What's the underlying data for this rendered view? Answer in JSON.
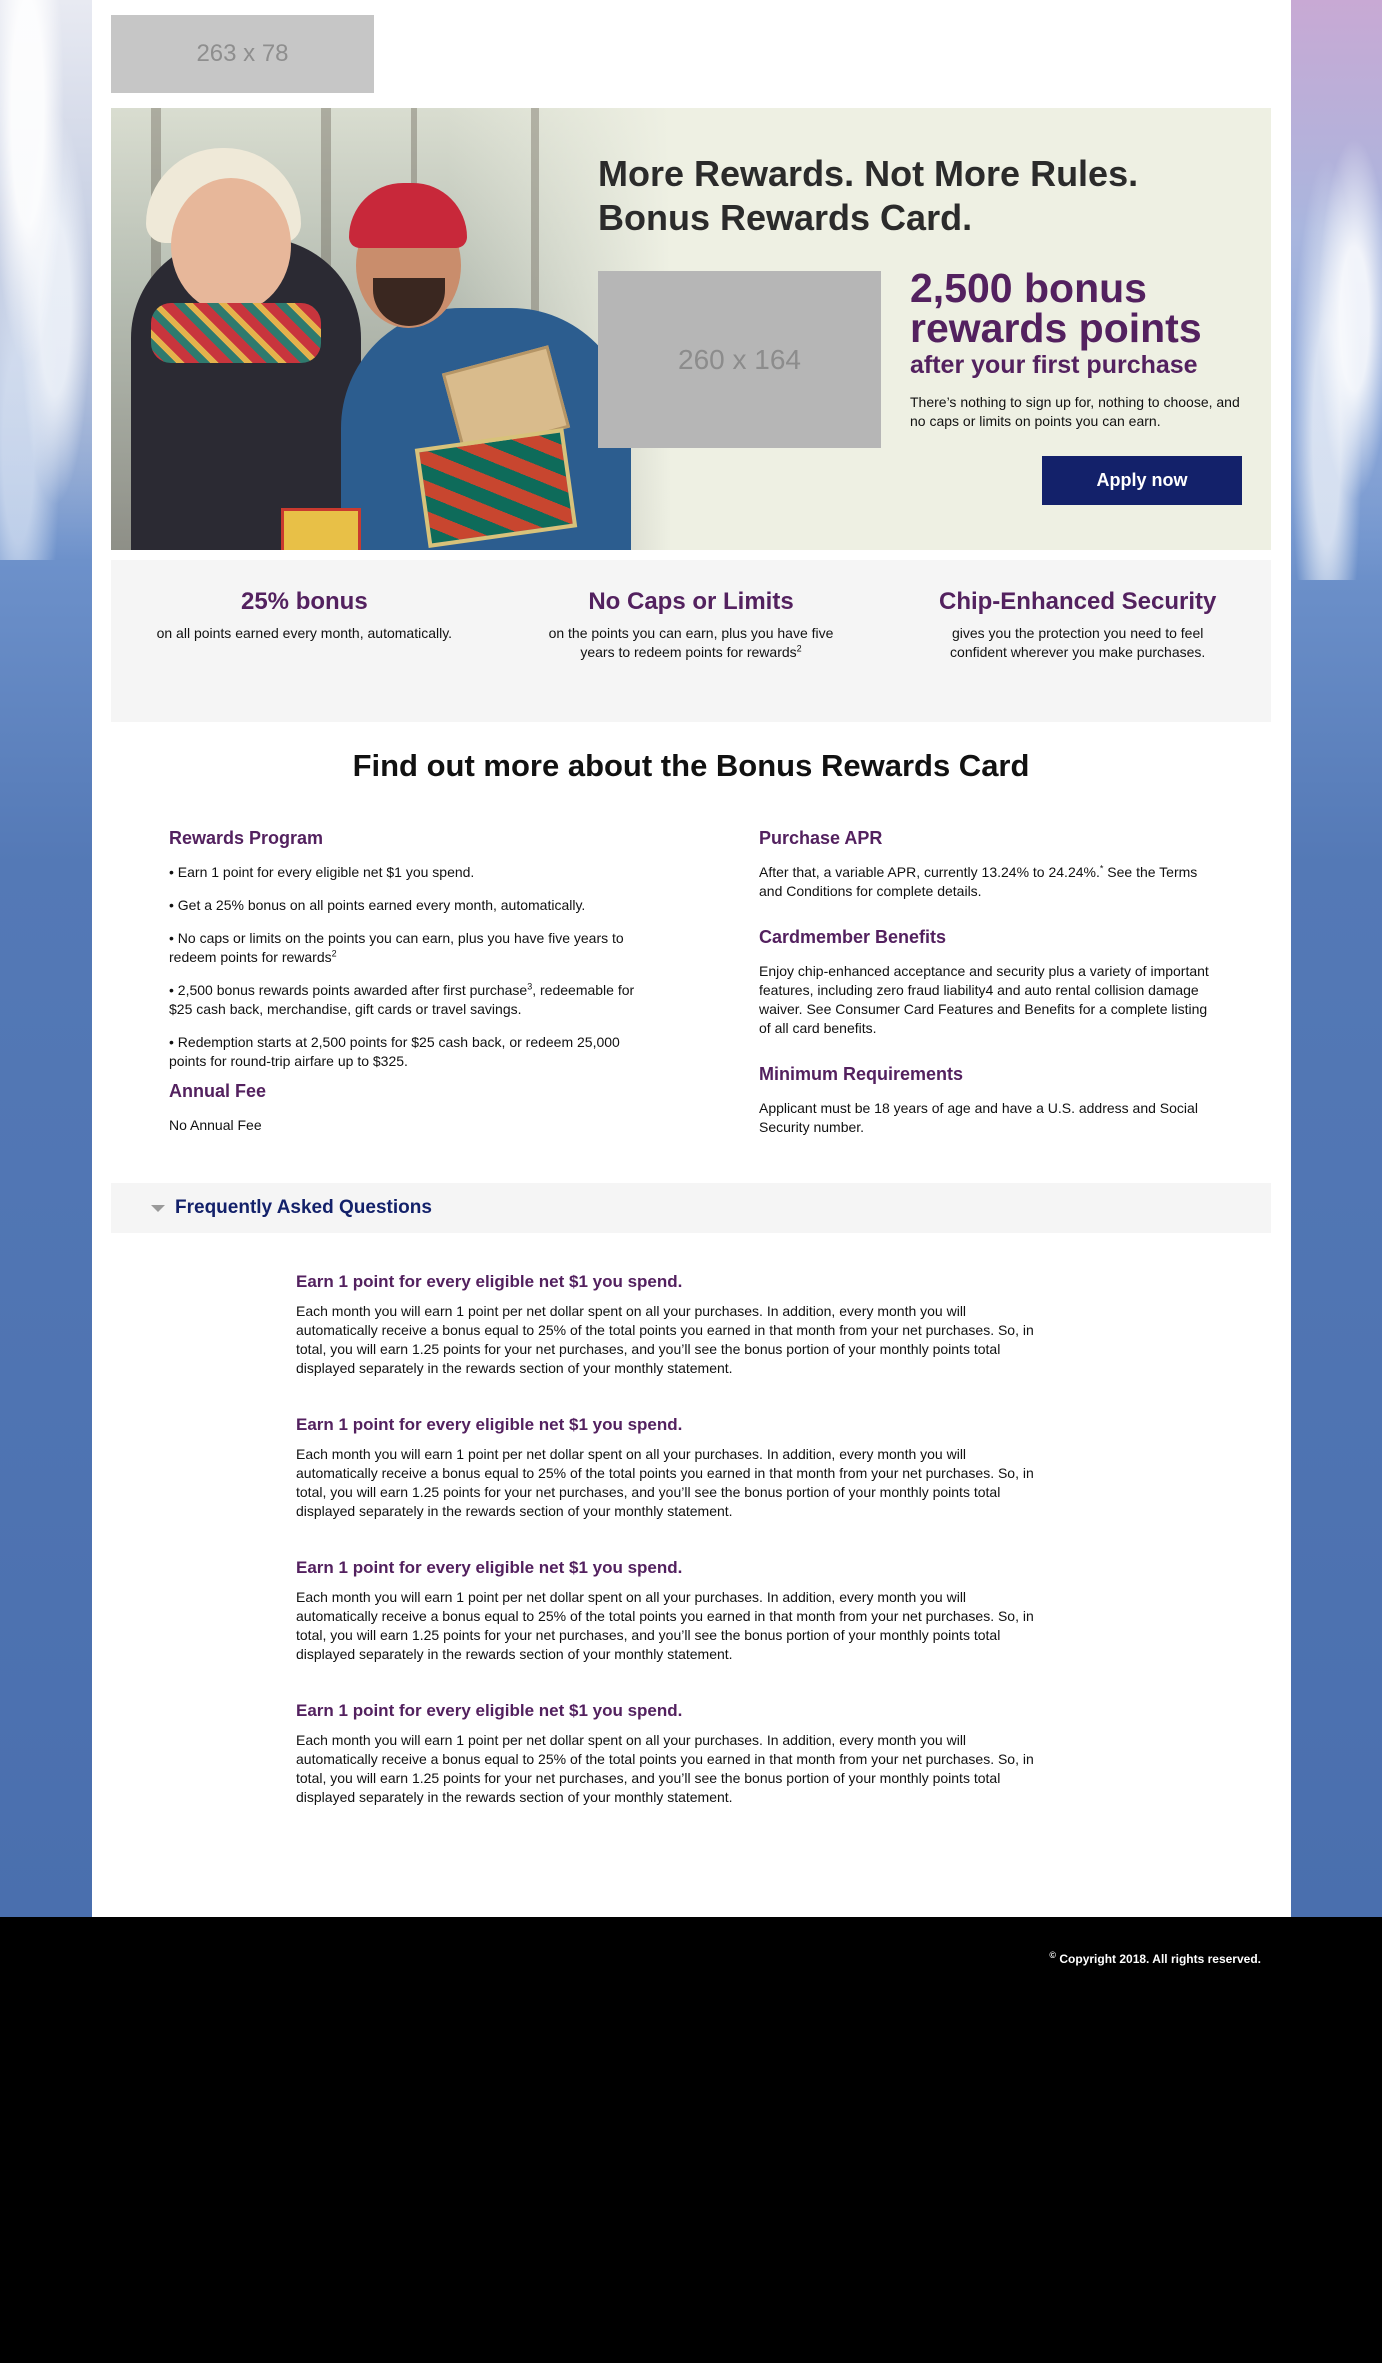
{
  "header": {
    "logo_placeholder": "263 x 78"
  },
  "hero": {
    "title_line1": "More Rewards. Not More Rules.",
    "title_line2": "Bonus Rewards Card.",
    "image_placeholder": "260 x 164",
    "bonus_line1": "2,500 bonus",
    "bonus_line2": "rewards points",
    "bonus_sub": "after your first purchase",
    "description": "There’s nothing to sign up for, nothing to choose, and no caps or limits on points you can earn.",
    "apply_label": "Apply now"
  },
  "features": [
    {
      "title": "25% bonus",
      "text": "on all points earned every month, automatically."
    },
    {
      "title": "No Caps or Limits",
      "text": "on the points you can earn, plus you have five years to redeem points for rewards",
      "sup": "2"
    },
    {
      "title": "Chip-Enhanced Security",
      "text": "gives you the protection you need to feel confident wherever you make purchases."
    }
  ],
  "details": {
    "title": "Find out more about the Bonus Rewards Card",
    "rewards_program": {
      "heading": "Rewards Program",
      "bullet1": "• Earn 1 point for every eligible net $1 you spend.",
      "bullet2": "• Get a 25% bonus on all points earned every month, automatically.",
      "bullet3": "• No caps or limits on the points you can earn, plus you have five years to redeem points for rewards",
      "bullet3_sup": "2",
      "bullet4_a": "• 2,500 bonus rewards points awarded after first purchase",
      "bullet4_sup": "3",
      "bullet4_b": ", redeemable for $25 cash back, merchandise, gift cards or travel savings.",
      "bullet5": "• Redemption starts at 2,500 points for $25 cash back, or redeem 25,000 points for round-trip airfare up to $325."
    },
    "annual_fee": {
      "heading": "Annual Fee",
      "text": "No Annual Fee"
    },
    "purchase_apr": {
      "heading": "Purchase APR",
      "text_a": "After that, a variable APR, currently 13.24% to 24.24%.",
      "sup": "*",
      "text_b": " See the Terms and Conditions for complete details."
    },
    "cardmember_benefits": {
      "heading": "Cardmember Benefits",
      "text": "Enjoy chip-enhanced acceptance and security plus a variety of important features, including zero fraud liability4 and auto rental collision damage waiver. See Consumer Card Features and Benefits for a complete listing of all card benefits."
    },
    "minimum_requirements": {
      "heading": "Minimum Requirements",
      "text": "Applicant must be 18 years of age and have a U.S. address and Social Security number."
    }
  },
  "faq": {
    "title": "Frequently Asked Questions",
    "items": [
      {
        "question": "Earn 1 point for every eligible net $1 you spend.",
        "answer": "Each month you will earn 1 point per net dollar spent on all your purchases. In addition, every month you will automatically receive a bonus equal to 25% of the total points you earned in that month from your net purchases. So, in total, you will earn 1.25 points for your net purchases, and you’ll see the bonus portion of your monthly points total displayed separately in the rewards section of your monthly statement."
      },
      {
        "question": "Earn 1 point for every eligible net $1 you spend.",
        "answer": "Each month you will earn 1 point per net dollar spent on all your purchases. In addition, every month you will automatically receive a bonus equal to 25% of the total points you earned in that month from your net purchases. So, in total, you will earn 1.25 points for your net purchases, and you’ll see the bonus portion of your monthly points total displayed separately in the rewards section of your monthly statement."
      },
      {
        "question": "Earn 1 point for every eligible net $1 you spend.",
        "answer": "Each month you will earn 1 point per net dollar spent on all your purchases. In addition, every month you will automatically receive a bonus equal to 25% of the total points you earned in that month from your net purchases. So, in total, you will earn 1.25 points for your net purchases, and you’ll see the bonus portion of your monthly points total displayed separately in the rewards section of your monthly statement."
      },
      {
        "question": "Earn 1 point for every eligible net $1 you spend.",
        "answer": "Each month you will earn 1 point per net dollar spent on all your purchases. In addition, every month you will automatically receive a bonus equal to 25% of the total points you earned in that month from your net purchases. So, in total, you will earn 1.25 points for your net purchases, and you’ll see the bonus portion of your monthly points total displayed separately in the rewards section of your monthly statement."
      }
    ]
  },
  "footer": {
    "copyright_symbol": "©",
    "copyright": " Copyright 2018. All rights reserved."
  },
  "colors": {
    "brand_purple": "#53215f",
    "brand_navy": "#13216a",
    "hero_bg": "#eef0e3"
  }
}
